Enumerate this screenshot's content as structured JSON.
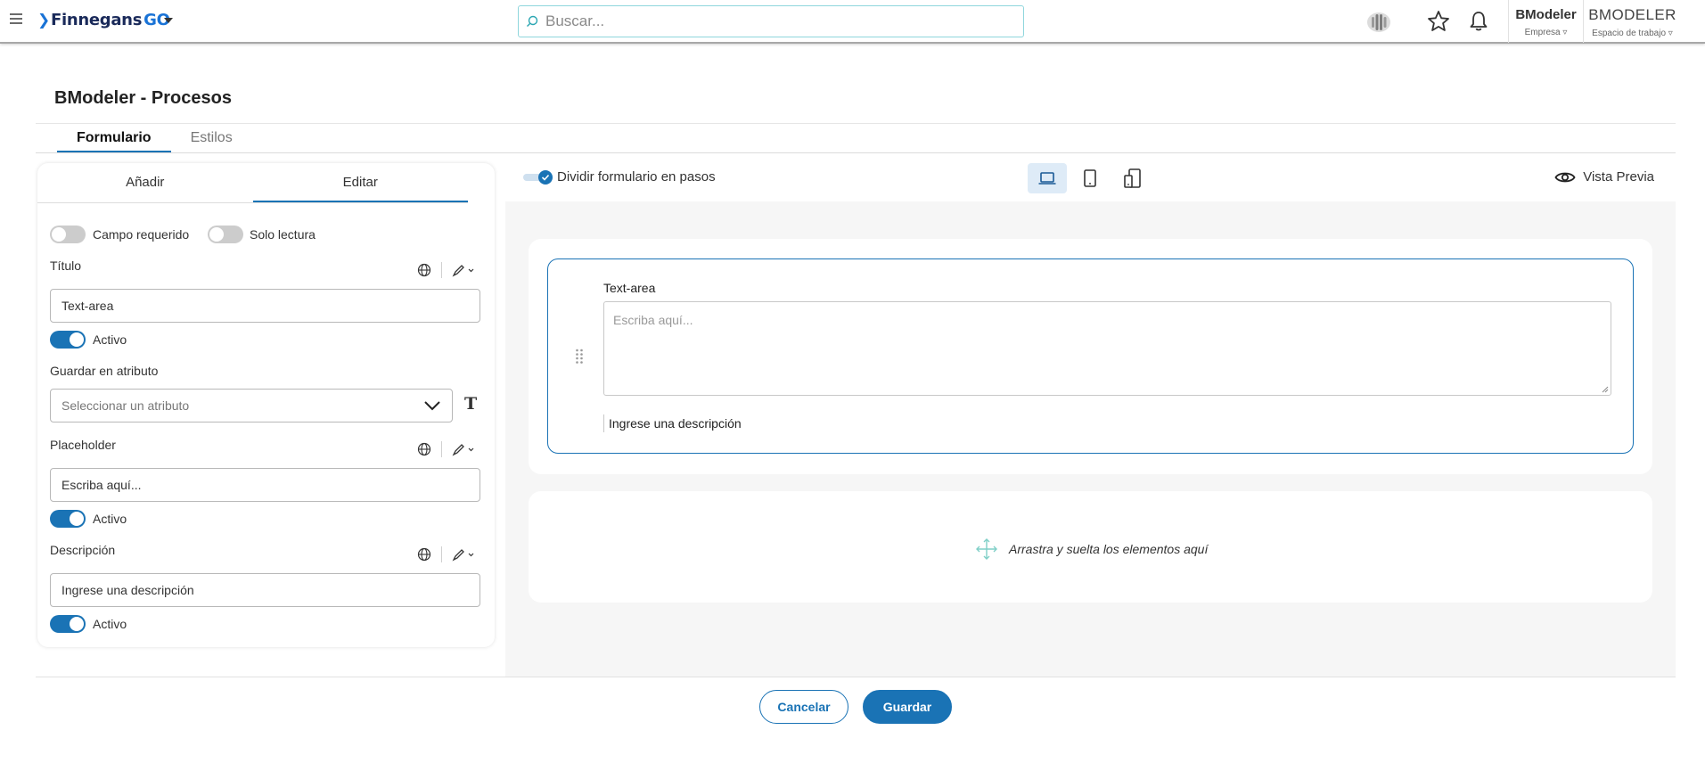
{
  "header": {
    "logo_text": "Finnegans",
    "logo_suffix": "GO",
    "search_placeholder": "Buscar...",
    "company": {
      "name": "BModeler",
      "label": "Empresa"
    },
    "workspace": {
      "name": "BMODELER",
      "label": "Espacio de trabajo"
    }
  },
  "page": {
    "title": "BModeler - Procesos",
    "tabs": [
      {
        "label": "Formulario",
        "active": true
      },
      {
        "label": "Estilos",
        "active": false
      }
    ]
  },
  "left_panel": {
    "tabs": [
      {
        "label": "Añadir",
        "active": false
      },
      {
        "label": "Editar",
        "active": true
      }
    ],
    "required_label": "Campo requerido",
    "required_on": false,
    "readonly_label": "Solo lectura",
    "readonly_on": false,
    "title_label": "Título",
    "title_value": "Text-area",
    "title_active_label": "Activo",
    "save_attr_label": "Guardar en atributo",
    "save_attr_placeholder": "Seleccionar un atributo",
    "placeholder_label": "Placeholder",
    "placeholder_value": "Escriba aquí...",
    "placeholder_active_label": "Activo",
    "description_label": "Descripción",
    "description_value": "Ingrese una descripción",
    "description_active_label": "Activo"
  },
  "canvas": {
    "split_label": "Dividir formulario en pasos",
    "split_on": true,
    "preview_label": "Vista Previa",
    "devices": [
      {
        "name": "laptop-icon",
        "active": true
      },
      {
        "name": "tablet-icon",
        "active": false
      },
      {
        "name": "responsive-icon",
        "active": false
      }
    ],
    "field": {
      "label": "Text-area",
      "placeholder": "Escriba aquí...",
      "description": "Ingrese una descripción"
    },
    "drop_text": "Arrastra y suelta los elementos aquí"
  },
  "actions": {
    "cancel_label": "Cancelar",
    "save_label": "Guardar"
  },
  "colors": {
    "accent": "#1a73b5",
    "search_border": "#8fd6dc",
    "canvas_bg": "#f6f6f6"
  }
}
